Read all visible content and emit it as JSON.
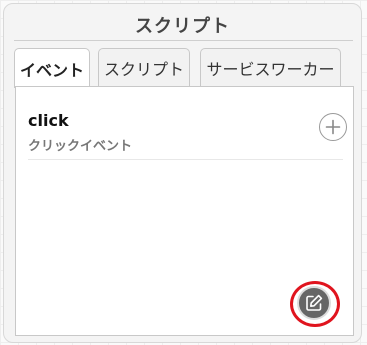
{
  "panel": {
    "title": "スクリプト"
  },
  "tabs": [
    {
      "label": "イベント",
      "active": true
    },
    {
      "label": "スクリプト",
      "active": false
    },
    {
      "label": "サービスワーカー",
      "active": false
    }
  ],
  "events": [
    {
      "name": "click",
      "description": "クリックイベント"
    }
  ],
  "icons": {
    "add": "plus-icon",
    "edit": "edit-pencil-icon"
  },
  "colors": {
    "tab_accent": "#4a90d9",
    "highlight": "#e0141e",
    "edit_button": "#666666"
  }
}
